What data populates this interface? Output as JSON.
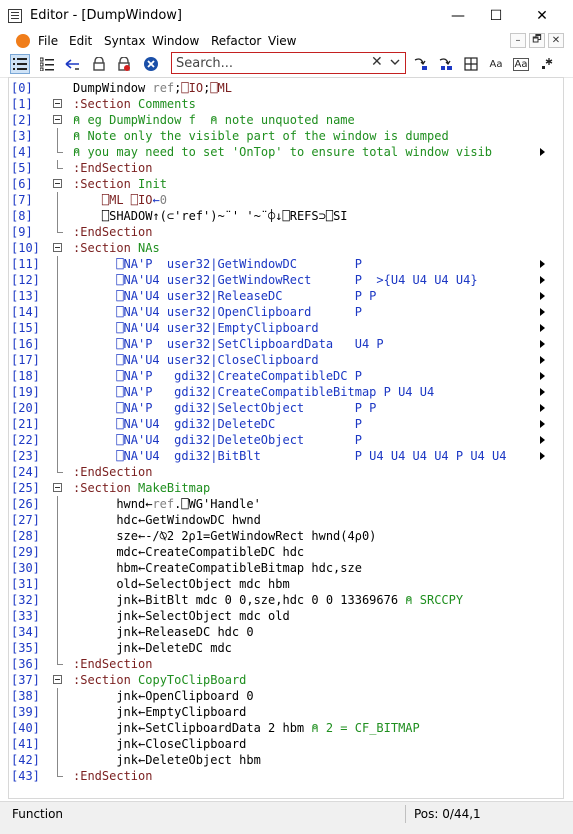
{
  "window": {
    "title": "Editor - [DumpWindow]",
    "minimize_glyph": "—",
    "maximize_glyph": "☐",
    "close_glyph": "✕"
  },
  "menu": {
    "items": [
      "File",
      "Edit",
      "Syntax",
      "Window",
      "Refactor",
      "View"
    ],
    "mdi_buttons": [
      "–",
      "🗗",
      "✕"
    ]
  },
  "toolbar": {
    "buttons": [
      {
        "name": "list-numbered-icon",
        "glyph": "☰",
        "active": true
      },
      {
        "name": "list-tree-icon",
        "glyph": "☷",
        "active": false
      },
      {
        "name": "back-arrow-icon",
        "glyph": "⮌",
        "active": false
      },
      {
        "name": "lock-icon",
        "glyph": "🔒",
        "active": false
      },
      {
        "name": "lock-red-icon",
        "glyph": "🔒",
        "active": false
      },
      {
        "name": "stop-icon",
        "glyph": "✖",
        "active": false
      }
    ],
    "right_buttons": [
      {
        "name": "replace-icon",
        "glyph": "⤼"
      },
      {
        "name": "replace-all-icon",
        "glyph": "⤼"
      },
      {
        "name": "grid-icon",
        "glyph": "⊞"
      },
      {
        "name": "match-case-icon",
        "glyph": "Aa"
      },
      {
        "name": "whole-word-icon",
        "glyph": "Aa"
      },
      {
        "name": "regex-icon",
        "glyph": ".*"
      }
    ],
    "search": {
      "placeholder": "Search...",
      "value": "",
      "clear": "✕",
      "dropdown": "❯"
    }
  },
  "colors": {
    "line_number": "#1c38c4",
    "comment": "#1f8f1f",
    "keyword": "#7a1f1f",
    "identifier": "#000000",
    "string": "#7a1f1f",
    "number": "#808080",
    "primitive": "#1c38c4",
    "system": "#7a1f1f",
    "hex_lit": "#1f8f1f"
  },
  "lines": [
    {
      "n": "[0]",
      "indent": 0,
      "fold": "none",
      "more": false,
      "tokens": [
        [
          "DumpWindow ",
          "identifier"
        ],
        [
          "ref",
          "number"
        ],
        [
          ";",
          "identifier"
        ],
        [
          "⎕IO",
          "system"
        ],
        [
          ";",
          "identifier"
        ],
        [
          "⎕ML",
          "system"
        ]
      ]
    },
    {
      "n": "[1]",
      "indent": 0,
      "fold": "open",
      "more": false,
      "tokens": [
        [
          ":Section ",
          "keyword"
        ],
        [
          "Comments",
          "comment"
        ]
      ]
    },
    {
      "n": "[2]",
      "indent": 0,
      "fold": "open",
      "more": false,
      "tokens": [
        [
          "⍝ eg DumpWindow f  ⍝ note unquoted name",
          "comment"
        ]
      ]
    },
    {
      "n": "[3]",
      "indent": 0,
      "fold": "line",
      "more": false,
      "tokens": [
        [
          "⍝ Note only the visible part of the window is dumped",
          "comment"
        ]
      ]
    },
    {
      "n": "[4]",
      "indent": 0,
      "fold": "end",
      "more": true,
      "tokens": [
        [
          "⍝ you may need to set 'OnTop' to ensure total window visib",
          "comment"
        ]
      ]
    },
    {
      "n": "[5]",
      "indent": 0,
      "fold": "end",
      "more": false,
      "tokens": [
        [
          ":EndSection",
          "keyword"
        ]
      ]
    },
    {
      "n": "[6]",
      "indent": 0,
      "fold": "open",
      "more": false,
      "tokens": [
        [
          ":Section ",
          "keyword"
        ],
        [
          "Init",
          "comment"
        ]
      ]
    },
    {
      "n": "[7]",
      "indent": 2,
      "fold": "line",
      "more": false,
      "tokens": [
        [
          "⎕ML ",
          "system"
        ],
        [
          "⎕IO",
          "system"
        ],
        [
          "←",
          "primitive"
        ],
        [
          "0",
          "number"
        ]
      ]
    },
    {
      "n": "[8]",
      "indent": 2,
      "fold": "line",
      "more": false,
      "tokens": [
        [
          "⎕SHADOW↑(⊂'ref')~¨' '~¨⌽↓⎕REFS⊃⎕SI",
          "identifier"
        ]
      ]
    },
    {
      "n": "[9]",
      "indent": 0,
      "fold": "end",
      "more": false,
      "tokens": [
        [
          ":EndSection",
          "keyword"
        ]
      ]
    },
    {
      "n": "[10]",
      "indent": 0,
      "fold": "open",
      "more": false,
      "tokens": [
        [
          ":Section ",
          "keyword"
        ],
        [
          "NAs",
          "comment"
        ]
      ]
    },
    {
      "n": "[11]",
      "indent": 3,
      "fold": "line",
      "more": true,
      "tokens": [
        [
          "⎕NA'P  user32|GetWindowDC        P",
          "primitive"
        ]
      ]
    },
    {
      "n": "[12]",
      "indent": 3,
      "fold": "line",
      "more": true,
      "tokens": [
        [
          "⎕NA'U4 user32|GetWindowRect      P  >{U4 U4 U4 U4}",
          "primitive"
        ]
      ]
    },
    {
      "n": "[13]",
      "indent": 3,
      "fold": "line",
      "more": true,
      "tokens": [
        [
          "⎕NA'U4 user32|ReleaseDC          P P",
          "primitive"
        ]
      ]
    },
    {
      "n": "[14]",
      "indent": 3,
      "fold": "line",
      "more": true,
      "tokens": [
        [
          "⎕NA'U4 user32|OpenClipboard      P",
          "primitive"
        ]
      ]
    },
    {
      "n": "[15]",
      "indent": 3,
      "fold": "line",
      "more": true,
      "tokens": [
        [
          "⎕NA'U4 user32|EmptyClipboard",
          "primitive"
        ]
      ]
    },
    {
      "n": "[16]",
      "indent": 3,
      "fold": "line",
      "more": true,
      "tokens": [
        [
          "⎕NA'P  user32|SetClipboardData   U4 P",
          "primitive"
        ]
      ]
    },
    {
      "n": "[17]",
      "indent": 3,
      "fold": "line",
      "more": true,
      "tokens": [
        [
          "⎕NA'U4 user32|CloseClipboard",
          "primitive"
        ]
      ]
    },
    {
      "n": "[18]",
      "indent": 3,
      "fold": "line",
      "more": true,
      "tokens": [
        [
          "⎕NA'P   gdi32|CreateCompatibleDC P",
          "primitive"
        ]
      ]
    },
    {
      "n": "[19]",
      "indent": 3,
      "fold": "line",
      "more": true,
      "tokens": [
        [
          "⎕NA'P   gdi32|CreateCompatibleBitmap P U4 U4",
          "primitive"
        ]
      ]
    },
    {
      "n": "[20]",
      "indent": 3,
      "fold": "line",
      "more": true,
      "tokens": [
        [
          "⎕NA'P   gdi32|SelectObject       P P",
          "primitive"
        ]
      ]
    },
    {
      "n": "[21]",
      "indent": 3,
      "fold": "line",
      "more": true,
      "tokens": [
        [
          "⎕NA'U4  gdi32|DeleteDC           P",
          "primitive"
        ]
      ]
    },
    {
      "n": "[22]",
      "indent": 3,
      "fold": "line",
      "more": true,
      "tokens": [
        [
          "⎕NA'U4  gdi32|DeleteObject       P",
          "primitive"
        ]
      ]
    },
    {
      "n": "[23]",
      "indent": 3,
      "fold": "line",
      "more": true,
      "tokens": [
        [
          "⎕NA'U4  gdi32|BitBlt             P U4 U4 U4 U4 P U4 U4",
          "primitive"
        ]
      ]
    },
    {
      "n": "[24]",
      "indent": 0,
      "fold": "end",
      "more": false,
      "tokens": [
        [
          ":EndSection",
          "keyword"
        ]
      ]
    },
    {
      "n": "[25]",
      "indent": 0,
      "fold": "open",
      "more": false,
      "tokens": [
        [
          ":Section ",
          "keyword"
        ],
        [
          "MakeBitmap",
          "comment"
        ]
      ]
    },
    {
      "n": "[26]",
      "indent": 3,
      "fold": "line",
      "more": false,
      "tokens": [
        [
          "hwnd←",
          "identifier"
        ],
        [
          "ref",
          "number"
        ],
        [
          ".⎕WG'Handle'",
          "identifier"
        ]
      ]
    },
    {
      "n": "[27]",
      "indent": 3,
      "fold": "line",
      "more": false,
      "tokens": [
        [
          "hdc←GetWindowDC hwnd",
          "identifier"
        ]
      ]
    },
    {
      "n": "[28]",
      "indent": 3,
      "fold": "line",
      "more": false,
      "tokens": [
        [
          "sze←-/⍉2 2⍴1=GetWindowRect hwnd(4⍴0)",
          "identifier"
        ]
      ]
    },
    {
      "n": "[29]",
      "indent": 3,
      "fold": "line",
      "more": false,
      "tokens": [
        [
          "mdc←CreateCompatibleDC hdc",
          "identifier"
        ]
      ]
    },
    {
      "n": "[30]",
      "indent": 3,
      "fold": "line",
      "more": false,
      "tokens": [
        [
          "hbm←CreateCompatibleBitmap hdc,sze",
          "identifier"
        ]
      ]
    },
    {
      "n": "[31]",
      "indent": 3,
      "fold": "line",
      "more": false,
      "tokens": [
        [
          "old←SelectObject mdc hbm",
          "identifier"
        ]
      ]
    },
    {
      "n": "[32]",
      "indent": 3,
      "fold": "line",
      "more": false,
      "tokens": [
        [
          "jnk←BitBlt mdc 0 0,sze,hdc 0 0 13369676 ",
          "identifier"
        ],
        [
          "⍝ SRCCPY",
          "comment"
        ]
      ]
    },
    {
      "n": "[33]",
      "indent": 3,
      "fold": "line",
      "more": false,
      "tokens": [
        [
          "jnk←SelectObject mdc old",
          "identifier"
        ]
      ]
    },
    {
      "n": "[34]",
      "indent": 3,
      "fold": "line",
      "more": false,
      "tokens": [
        [
          "jnk←ReleaseDC hdc 0",
          "identifier"
        ]
      ]
    },
    {
      "n": "[35]",
      "indent": 3,
      "fold": "line",
      "more": false,
      "tokens": [
        [
          "jnk←DeleteDC mdc",
          "identifier"
        ]
      ]
    },
    {
      "n": "[36]",
      "indent": 0,
      "fold": "end",
      "more": false,
      "tokens": [
        [
          ":EndSection",
          "keyword"
        ]
      ]
    },
    {
      "n": "[37]",
      "indent": 0,
      "fold": "open",
      "more": false,
      "tokens": [
        [
          ":Section ",
          "keyword"
        ],
        [
          "CopyToClipBoard",
          "comment"
        ]
      ]
    },
    {
      "n": "[38]",
      "indent": 3,
      "fold": "line",
      "more": false,
      "tokens": [
        [
          "jnk←OpenClipboard 0",
          "identifier"
        ]
      ]
    },
    {
      "n": "[39]",
      "indent": 3,
      "fold": "line",
      "more": false,
      "tokens": [
        [
          "jnk←EmptyClipboard",
          "identifier"
        ]
      ]
    },
    {
      "n": "[40]",
      "indent": 3,
      "fold": "line",
      "more": false,
      "tokens": [
        [
          "jnk←SetClipboardData 2 hbm ",
          "identifier"
        ],
        [
          "⍝ 2 = CF_BITMAP",
          "comment"
        ]
      ]
    },
    {
      "n": "[41]",
      "indent": 3,
      "fold": "line",
      "more": false,
      "tokens": [
        [
          "jnk←CloseClipboard",
          "identifier"
        ]
      ]
    },
    {
      "n": "[42]",
      "indent": 3,
      "fold": "line",
      "more": false,
      "tokens": [
        [
          "jnk←DeleteObject hbm",
          "identifier"
        ]
      ]
    },
    {
      "n": "[43]",
      "indent": 0,
      "fold": "end",
      "more": false,
      "tokens": [
        [
          ":EndSection",
          "keyword"
        ]
      ]
    }
  ],
  "status": {
    "left": "Function",
    "right": "Pos: 0/44,1"
  }
}
